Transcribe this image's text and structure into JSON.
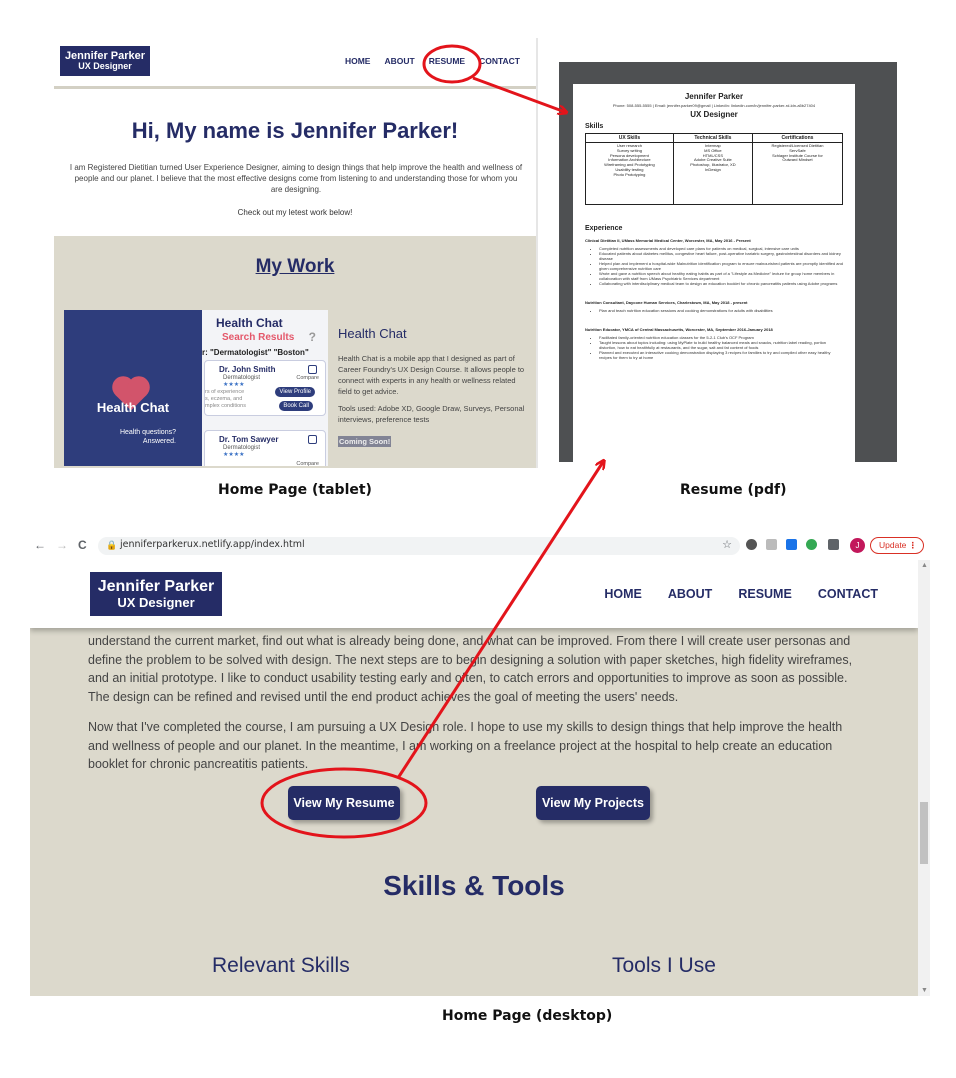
{
  "tablet": {
    "logo_name": "Jennifer Parker",
    "logo_role": "UX Designer",
    "nav": [
      "HOME",
      "ABOUT",
      "RESUME",
      "CONTACT"
    ],
    "hero_title": "Hi, My name is Jennifer Parker!",
    "hero_text": "I am Registered Dietitian turned User Experience Designer, aiming to design things that help improve the health and wellness of people and our planet. I believe that the most effective designs come from listening to and understanding those for whom you are designing.",
    "hero_cta": "Check out my letest work below!",
    "work_title": "My Work",
    "project": {
      "img_title": "Health Chat",
      "img_search_results": "Search Results",
      "img_question": "?",
      "img_search_terms": "r: \"Dermatologist\" \"Boston\"",
      "img_tagline_1": "Health questions?",
      "img_tagline_2": "Answered.",
      "doctor_1": "Dr. John Smith",
      "doctor_2": "Dr. Tom Sawyer",
      "doctor_title": "Dermatologist",
      "stars": "★★★★",
      "doctor_desc": "rs of experience\ns, eczema, and\nmplex conditions",
      "compare": "Compare",
      "view_profile": "View Profile",
      "book_call": "Book Call",
      "name": "Health Chat",
      "desc": "Health Chat is a mobile app that I designed as part of Career Foundry's UX Design Course. It allows people to connect with experts in any health or wellness related field to get advice.",
      "tools": "Tools used: Adobe XD, Google Draw, Surveys, Personal interviews, preference tests",
      "status": "Coming Soon!"
    }
  },
  "resume": {
    "name": "Jennifer Parker",
    "contact": "Phone: 508-555-5555 | Email: jennifer.parker09@gmail | LinkedIn: linkedin.com/in/jennifer-parker-rd-ldn-a5b27404",
    "role": "UX Designer",
    "skills_heading": "Skills",
    "table_headers": [
      "UX Skills",
      "Technical Skills",
      "Certifications"
    ],
    "ux_skills": "User research\nSurvey writing\nPersona development\nInformation Architecture\nWireframing and Prototyping\nUsability testing\nPhoto Prototyping",
    "tech_skills": "Intermap\nMS Office\nHTML/CSS\nAdobe Creative Suite\nPhotoshop, Illustrator, XD\nInDesign",
    "certifications": "Registered/Licensed Dietitian\nServSafe\nSchlager Institute Course for\nOutward Mindset",
    "experience_heading": "Experience",
    "jobs": [
      {
        "title": "Clinical Dietitian II, UMass Memorial Medical Center, Worcester, MA, May 2016 - Present",
        "bullets": [
          "Completed nutrition assessments and developed care plans for patients on medical, surgical, intensive care units",
          "Educated patients about diabetes mellitus, congestive heart failure, post-operative bariatric surgery, gastrointestinal disorders and kidney disease",
          "Helped plan and implement a hospital-wide Malnutrition identification program to ensure malnourished patients are promptly identified and given comprehensive nutrition care",
          "Wrote and gave a nutrition speech about healthy eating habits as part of a \"Lifestyle as Medicine\" lecture for group home members in collaboration with staff from UMass Psychiatric Services department",
          "Collaborating with interdisciplinary medical team to design an education booklet for chronic pancreatitis patients using Adobe programs"
        ]
      },
      {
        "title": "Nutrition Consultant, Daycone Human Services, Charlestown, MA, May 2018 - present",
        "bullets": [
          "Plan and teach nutrition education sessions and cooking demonstrations for adults with disabilities"
        ]
      },
      {
        "title": "Nutrition Educator, YMCA of Central Massachusetts, Worcester, MA, September 2016-January 2018",
        "bullets": [
          "Facilitated family-oriented nutrition education classes for the 5-2-1 Club's OCF Program",
          "Taught lessons about topics including: using MyPlate to build healthy balanced meals and snacks, nutrition label reading, portion distortion, how to eat healthfully at restaurants, and the sugar, salt and fat content of foods",
          "Planned and executed an interactive cooking demonstration displaying 3 recipes for families to try and compiled other easy healthy recipes for them to try at home"
        ]
      }
    ]
  },
  "captions": {
    "tablet": "Home Page (tablet)",
    "resume": "Resume (pdf)",
    "desktop": "Home Page (desktop)"
  },
  "browser": {
    "back_icon": "←",
    "forward_icon": "→",
    "reload_icon": "C",
    "url": "jenniferparkerux.netlify.app/index.html",
    "update_label": "Update",
    "profile_initial": "J"
  },
  "desktop": {
    "logo_name": "Jennifer Parker",
    "logo_role": "UX Designer",
    "nav": [
      "HOME",
      "ABOUT",
      "RESUME",
      "CONTACT"
    ],
    "para1": "understand the current market, find out what is already being done, and what can be improved. From there I will create user personas and define the problem to be solved with design. The next steps are to begin designing a solution with paper sketches, high fidelity wireframes, and an initial prototype. I like to conduct usability testing early and often, to catch errors and opportunities to improve as soon as possible. The design can be refined and revised until the end product achieves the goal of meeting the users' needs.",
    "para2": "Now that I've completed the course, I am pursuing a UX Design role. I hope to use my skills to design things that help improve the health and wellness of people and our planet. In the meantime, I am working on a freelance project at the hospital to help create an education booklet for chronic pancreatitis patients.",
    "btn_resume": "View My Resume",
    "btn_projects": "View My Projects",
    "skills_title": "Skills & Tools",
    "col_skills": "Relevant Skills",
    "col_tools": "Tools I Use"
  },
  "colors": {
    "brand_navy": "#252c66",
    "section_beige": "#dcd9cc",
    "annotation_red": "#e3141b"
  }
}
